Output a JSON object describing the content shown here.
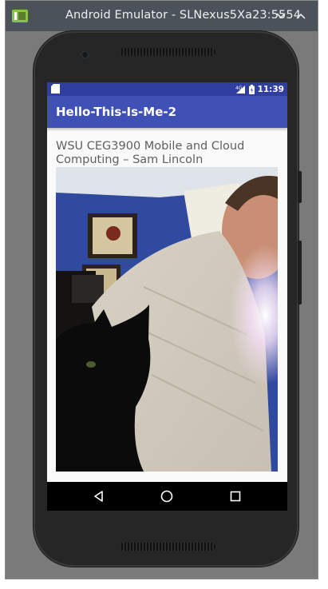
{
  "window": {
    "title": "Android Emulator - SLNexus5Xa23:5554",
    "icons": [
      "android-emulator-icon",
      "minimize-chevron-icon",
      "maximize-chevron-icon"
    ]
  },
  "statusbar": {
    "icons": [
      "sd-card-icon",
      "network-4g-icon",
      "battery-icon"
    ],
    "network_label": "4G",
    "time": "11:39"
  },
  "app": {
    "title": "Hello-This-Is-Me-2",
    "body_text": "WSU CEG3900 Mobile and Cloud Computing – Sam Lincoln",
    "photo_description_icon": "photo-image"
  },
  "navbar": {
    "icons": [
      "back-icon",
      "home-icon",
      "recents-icon"
    ]
  },
  "colors": {
    "status_bar": "#303f9f",
    "app_bar": "#3f51b5",
    "window_titlebar": "#4b525a"
  }
}
